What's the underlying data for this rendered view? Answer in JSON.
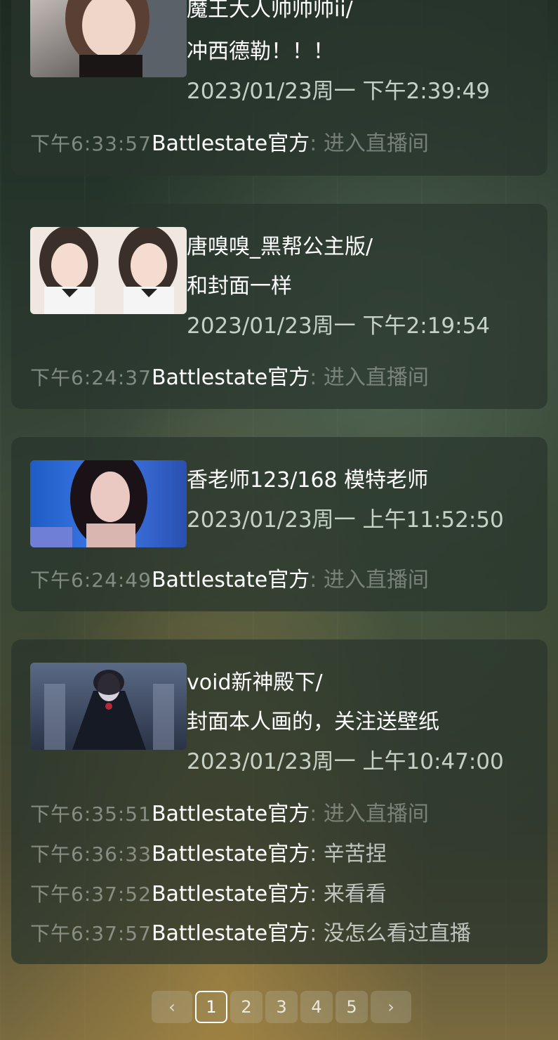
{
  "records": [
    {
      "title": "魔王大人帅帅帅ii/",
      "subtitle": "冲西德勒！！！",
      "datetime": "2023/01/23周一 下午2:39:49",
      "messages": [
        {
          "time": "下午6:33:57",
          "user": "Battlestate官方",
          "sep": ": ",
          "text": "进入直播间"
        }
      ]
    },
    {
      "title": "唐嗅嗅_黑帮公主版/",
      "subtitle": "和封面一样",
      "datetime": "2023/01/23周一 下午2:19:54",
      "messages": [
        {
          "time": "下午6:24:37",
          "user": "Battlestate官方",
          "sep": ": ",
          "text": "进入直播间"
        }
      ]
    },
    {
      "title": "香老师123/168 模特老师",
      "datetime": "2023/01/23周一 上午11:52:50",
      "messages": [
        {
          "time": "下午6:24:49",
          "user": "Battlestate官方",
          "sep": ": ",
          "text": "进入直播间"
        }
      ]
    },
    {
      "title": "void新神殿下/",
      "subtitle": "封面本人画的，关注送壁纸",
      "datetime": "2023/01/23周一 上午10:47:00",
      "messages": [
        {
          "time": "下午6:35:51",
          "user": "Battlestate官方",
          "sep": ": ",
          "text": "进入直播间"
        },
        {
          "time": "下午6:36:33",
          "user": "Battlestate官方",
          "sep": ": ",
          "text": "辛苦捏"
        },
        {
          "time": "下午6:37:52",
          "user": "Battlestate官方",
          "sep": ": ",
          "text": "来看看"
        },
        {
          "time": "下午6:37:57",
          "user": "Battlestate官方",
          "sep": ": ",
          "text": "没怎么看过直播"
        }
      ]
    }
  ],
  "pagination": {
    "prev": "‹",
    "next": "›",
    "pages": [
      "1",
      "2",
      "3",
      "4",
      "5"
    ],
    "current": "1"
  }
}
